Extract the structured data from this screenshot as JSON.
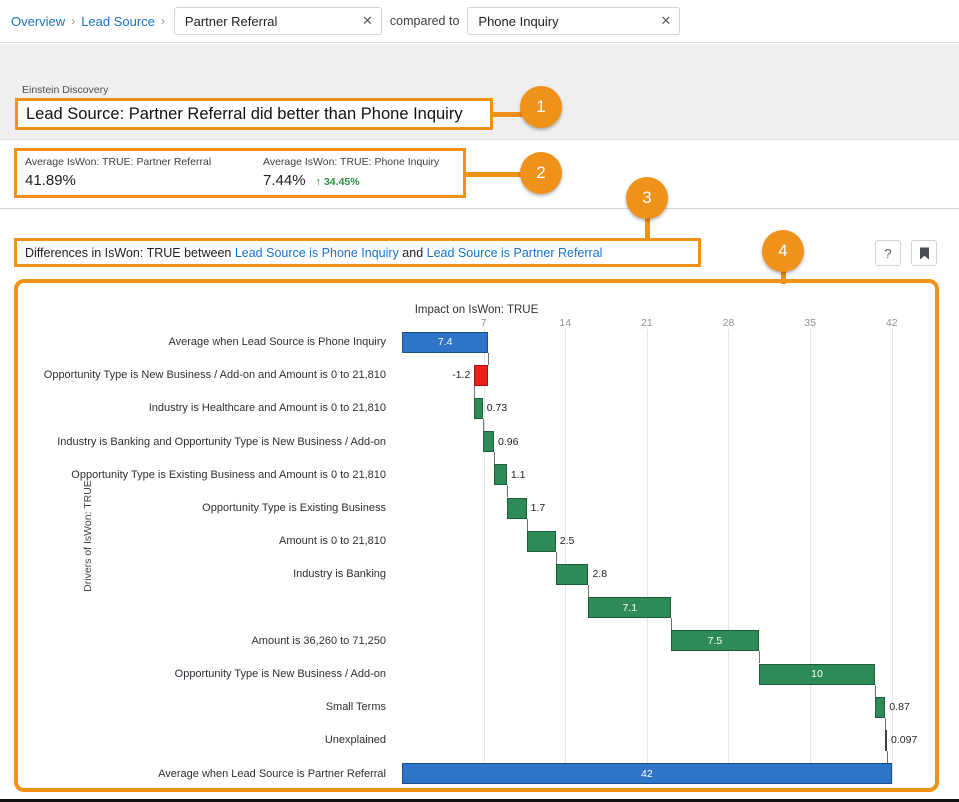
{
  "breadcrumb": {
    "items": [
      {
        "label": "Overview",
        "name": "crumb-overview"
      },
      {
        "label": "Lead Source",
        "name": "crumb-lead-source"
      }
    ],
    "separator": "›",
    "primary_filter": {
      "value": "Partner Referral",
      "clear": "✕"
    },
    "compared_to_label": "compared to",
    "secondary_filter": {
      "value": "Phone Inquiry",
      "clear": "✕"
    }
  },
  "header": {
    "eyebrow": "Einstein Discovery",
    "headline": "Lead Source: Partner Referral did better than Phone Inquiry"
  },
  "metrics": [
    {
      "caption": "Average IsWon: TRUE: Partner Referral",
      "value": "41.89%",
      "delta": null,
      "arrow": null
    },
    {
      "caption": "Average IsWon: TRUE: Phone Inquiry",
      "value": "7.44%",
      "delta": "34.45%",
      "arrow": "↑"
    }
  ],
  "difference_section": {
    "prefix": "Differences in IsWon: TRUE between ",
    "link_a": "Lead Source is Phone Inquiry",
    "middle": " and ",
    "link_b": "Lead Source is Partner Referral",
    "help_button": "?",
    "bookmark_button": "⚑"
  },
  "callouts": [
    {
      "number": "1"
    },
    {
      "number": "2"
    },
    {
      "number": "3"
    },
    {
      "number": "4"
    }
  ],
  "chart_data": {
    "type": "bar",
    "chart_subtype": "waterfall",
    "title": "Impact on IsWon: TRUE",
    "xlabel": "Impact on IsWon: TRUE",
    "ylabel": "Drivers of IsWon: TRUE",
    "xlim": [
      0,
      45
    ],
    "ticks": [
      7,
      14,
      21,
      28,
      35,
      42
    ],
    "grid": true,
    "legend": null,
    "categories": [
      "Average when Lead Source is Phone Inquiry",
      "Opportunity Type is New Business / Add-on and Amount is 0 to 21,810",
      "Industry is Healthcare and Amount is 0 to 21,810",
      "Industry is Banking and Opportunity Type is New Business / Add-on",
      "Opportunity Type is Existing Business and Amount is 0 to 21,810",
      "Opportunity Type is Existing Business",
      "Amount is 0 to 21,810",
      "Industry is Banking",
      "",
      "Amount is 36,260 to 71,250",
      "Opportunity Type is New Business / Add-on",
      "Small Terms",
      "Unexplained",
      "Average when Lead Source is Partner Referral"
    ],
    "values": [
      7.4,
      -1.2,
      0.73,
      0.96,
      1.1,
      1.7,
      2.5,
      2.8,
      7.1,
      7.5,
      10,
      0.87,
      0.097,
      42
    ],
    "value_labels": [
      "7.4",
      "-1.2",
      "0.73",
      "0.96",
      "1.1",
      "1.7",
      "2.5",
      "2.8",
      "7.1",
      "7.5",
      "10",
      "0.87",
      "0.097",
      "42"
    ],
    "bar_kinds": [
      "total",
      "negative",
      "positive",
      "positive",
      "positive",
      "positive",
      "positive",
      "positive",
      "positive",
      "positive",
      "positive",
      "positive",
      "positive",
      "total"
    ],
    "colors": {
      "total": "#2e75c7",
      "positive": "#2e8b57",
      "negative": "#e8201a",
      "accent": "#f0911a",
      "link": "#1a73c9",
      "up": "#2e8b46"
    }
  }
}
